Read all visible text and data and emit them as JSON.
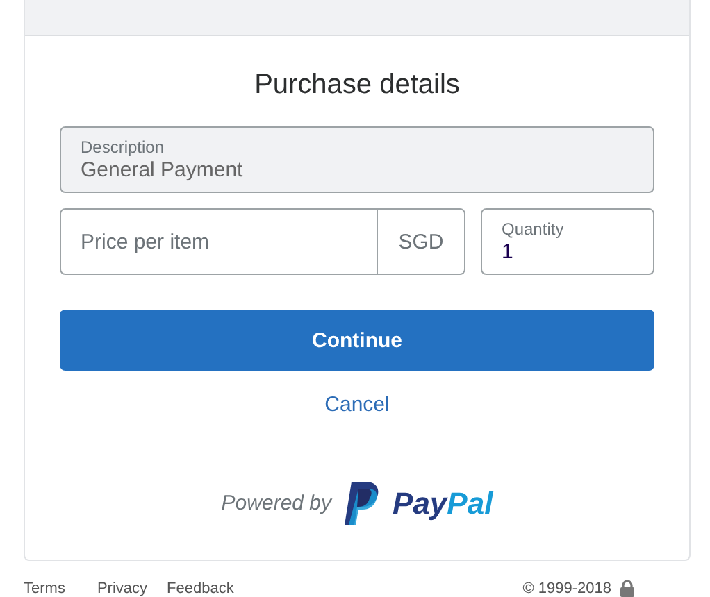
{
  "heading": "Purchase details",
  "description": {
    "label": "Description",
    "value": "General Payment",
    "disabled": true
  },
  "price": {
    "placeholder": "Price per item",
    "currency": "SGD"
  },
  "quantity": {
    "label": "Quantity",
    "value": "1"
  },
  "continue_button": "Continue",
  "cancel_link": "Cancel",
  "powered_by": {
    "text": "Powered by",
    "brand": [
      "Pay",
      "Pal"
    ]
  },
  "footer": {
    "links": [
      "Terms",
      "Privacy",
      "Feedback"
    ],
    "copyright": "© 1999-2018"
  }
}
